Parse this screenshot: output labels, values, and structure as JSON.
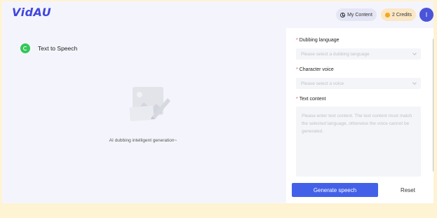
{
  "app": {
    "logo": "VidAU"
  },
  "header": {
    "my_content_label": "My Content",
    "credits_label": "2 Credits",
    "avatar_initial": "I"
  },
  "sidebar": {
    "tool_label": "Text to Speech"
  },
  "main": {
    "empty_caption": "AI dubbing intelligent generation~"
  },
  "form": {
    "dubbing_language": {
      "label": "Dubbing language",
      "placeholder": "Please select a dubbing language"
    },
    "character_voice": {
      "label": "Character voice",
      "placeholder": "Please select a voice"
    },
    "text_content": {
      "label": "Text content",
      "placeholder": "Please enter text content. The text content must match the selected language, otherwise the voice cannot be generated."
    },
    "required_marker": "*",
    "generate_label": "Generate speech",
    "reset_label": "Reset"
  },
  "colors": {
    "accent": "#4361e8",
    "logo": "#4146de",
    "page_background": "#fef3d3",
    "app_background": "#f4f5fc",
    "required": "#f04a4a"
  },
  "icons": [
    "clock-icon",
    "coin-icon",
    "text-to-speech-icon",
    "image-placeholder-icon",
    "chevron-down-icon"
  ]
}
